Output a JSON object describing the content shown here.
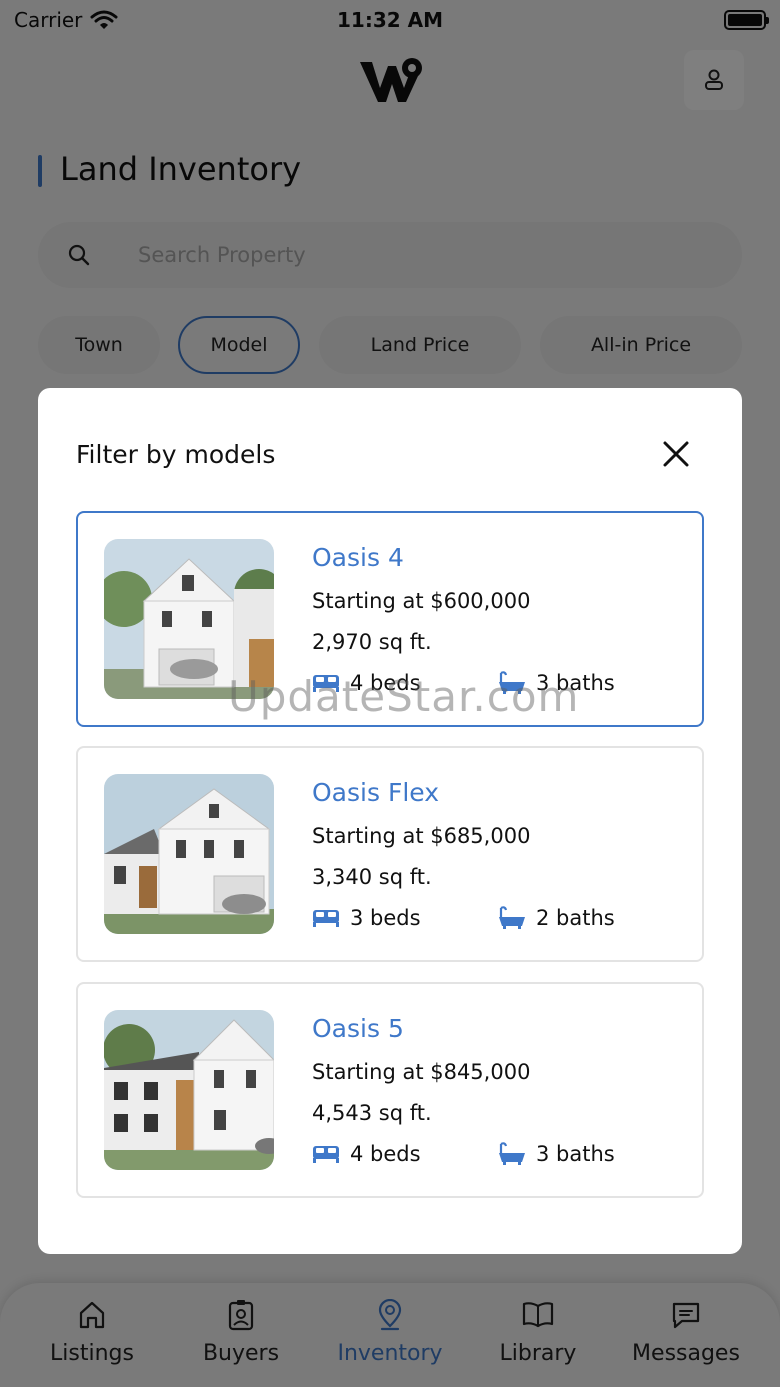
{
  "status": {
    "carrier": "Carrier",
    "time": "11:32 AM"
  },
  "header": {
    "logo_icon": "w-location-logo-icon",
    "profile_icon": "user-icon"
  },
  "page": {
    "title": "Land Inventory"
  },
  "search": {
    "placeholder": "Search Property",
    "icon": "search-icon"
  },
  "filters": {
    "chips": [
      "Town",
      "Model",
      "Land Price",
      "All-in Price"
    ],
    "active": "Model"
  },
  "modal": {
    "title": "Filter by models",
    "close_icon": "close-icon",
    "models": [
      {
        "name": "Oasis 4",
        "price": "Starting at $600,000",
        "area": "2,970 sq ft.",
        "beds": "4 beds",
        "baths": "3 baths",
        "selected": true
      },
      {
        "name": "Oasis Flex",
        "price": "Starting at $685,000",
        "area": "3,340 sq ft.",
        "beds": "3 beds",
        "baths": "2 baths",
        "selected": false
      },
      {
        "name": "Oasis 5",
        "price": "Starting at $845,000",
        "area": "4,543 sq ft.",
        "beds": "4 beds",
        "baths": "3 baths",
        "selected": false
      }
    ]
  },
  "tabbar": {
    "tabs": [
      {
        "label": "Listings",
        "icon": "home-icon"
      },
      {
        "label": "Buyers",
        "icon": "contact-card-icon"
      },
      {
        "label": "Inventory",
        "icon": "location-pin-icon"
      },
      {
        "label": "Library",
        "icon": "book-icon"
      },
      {
        "label": "Messages",
        "icon": "message-icon"
      }
    ],
    "active": "Inventory"
  },
  "watermark": "UpdateStar.com",
  "colors": {
    "accent": "#3f78c9",
    "overlay": "rgba(0,0,0,0.5)",
    "card_border": "#e3e3e3"
  }
}
